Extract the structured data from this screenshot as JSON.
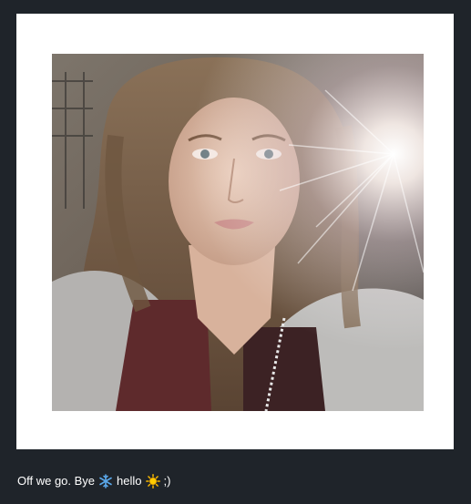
{
  "post": {
    "photo": {
      "alt_icon": "photo-image",
      "frame_color": "#ffffff"
    },
    "caption": {
      "part1": "Off we go. Bye",
      "emoji1": "snowflake-icon",
      "part2": "hello",
      "emoji2": "sun-icon",
      "part3": ";)"
    }
  },
  "colors": {
    "background": "#1f242a",
    "text": "#ffffff"
  }
}
